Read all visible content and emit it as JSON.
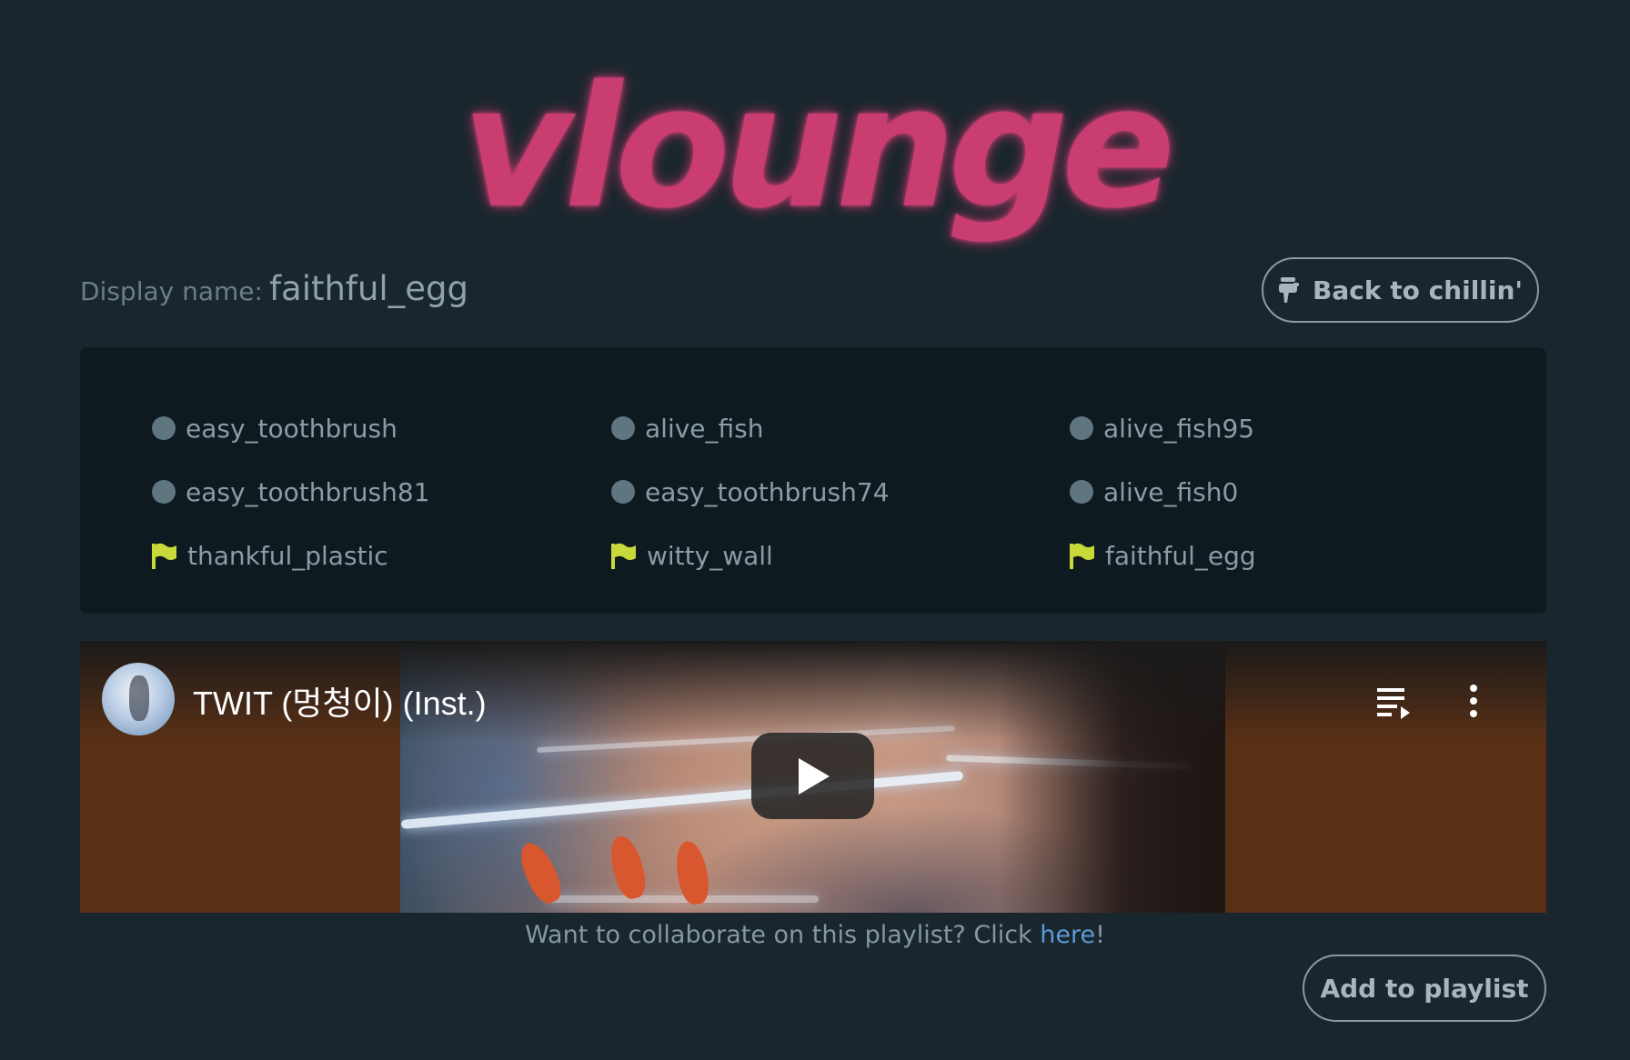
{
  "app": {
    "logo_text": "vlounge",
    "accent_color": "#c93d70"
  },
  "header": {
    "display_label": "Display name:",
    "display_value": "faithful_egg",
    "back_button_label": "Back to chillin'",
    "back_button_icon": "thumbs-down-icon"
  },
  "users": [
    {
      "name": "easy_toothbrush",
      "icon": "dot-icon"
    },
    {
      "name": "alive_fish",
      "icon": "dot-icon"
    },
    {
      "name": "alive_fish95",
      "icon": "dot-icon"
    },
    {
      "name": "easy_toothbrush81",
      "icon": "dot-icon"
    },
    {
      "name": "easy_toothbrush74",
      "icon": "dot-icon"
    },
    {
      "name": "alive_fish0",
      "icon": "dot-icon"
    },
    {
      "name": "thankful_plastic",
      "icon": "flag-icon"
    },
    {
      "name": "witty_wall",
      "icon": "flag-icon"
    },
    {
      "name": "faithful_egg",
      "icon": "flag-icon"
    }
  ],
  "video": {
    "title": "TWIT (멍청이) (Inst.)",
    "queue_icon": "playlist-queue-icon",
    "more_icon": "more-vertical-icon",
    "play_icon": "play-icon"
  },
  "footer": {
    "collab_prefix": "Want to collaborate on this playlist? Click ",
    "collab_link": "here",
    "collab_suffix": "!",
    "add_button_label": "Add to playlist"
  },
  "colors": {
    "background": "#1a262d",
    "panel": "#0f1a20",
    "link": "#5b9ad6",
    "flag": "#c8d93a",
    "dot": "#5f7580"
  }
}
